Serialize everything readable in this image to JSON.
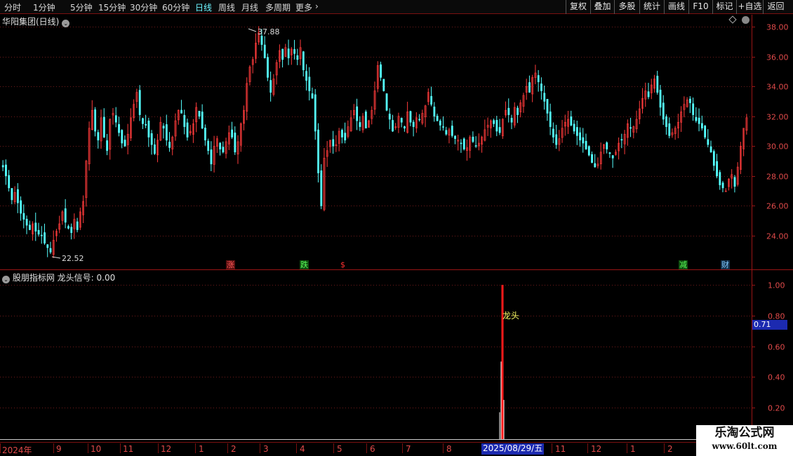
{
  "toolbar": {
    "periods": [
      "分时",
      "1分钟",
      "5分钟",
      "15分钟",
      "30分钟",
      "60分钟",
      "日线",
      "周线",
      "月线",
      "多周期",
      "更多"
    ],
    "active_period": "日线",
    "more_chevron": "›",
    "buttons": [
      "复权",
      "叠加",
      "多股",
      "统计",
      "画线",
      "F10",
      "标记",
      "+自选",
      "返回"
    ]
  },
  "main_panel": {
    "title": "华阳集团(日线)",
    "high_label": "37.88",
    "low_label": "22.52",
    "y_ticks": [
      "38.00",
      "36.00",
      "34.00",
      "32.00",
      "30.00",
      "28.00",
      "26.00",
      "24.00"
    ],
    "events": [
      {
        "text": "涨",
        "color": "#ff5a5a",
        "bg": "#5a1010"
      },
      {
        "text": "跌",
        "color": "#5aff5a",
        "bg": "#0f4a0f"
      },
      {
        "text": "$",
        "color": "#ff3030",
        "bg": "transparent"
      },
      {
        "text": "减",
        "color": "#5aff5a",
        "bg": "#0f4a0f"
      },
      {
        "text": "财",
        "color": "#7ec8ff",
        "bg": "#14304a"
      }
    ]
  },
  "indicator_panel": {
    "title": "股朋指标网 龙头信号: 0.00",
    "signal_label": "龙头",
    "current_value": "0.71",
    "y_ticks": [
      "1.00",
      "0.80",
      "0.60",
      "0.40",
      "0.20"
    ]
  },
  "time_axis": {
    "labels": [
      "2024年",
      "9",
      "10",
      "11",
      "12",
      "1",
      "2",
      "3",
      "4",
      "5",
      "6",
      "7",
      "8",
      "11",
      "12",
      "1",
      "2"
    ],
    "cursor_date": "2025/08/29/五"
  },
  "watermark": {
    "title": "乐淘公式网",
    "url": "www.60lt.com"
  },
  "colors": {
    "up": "#ff3b3b",
    "down": "#54ffff",
    "grid": "#6e1a1a",
    "axis_text": "#e04a4a",
    "active_period": "#6cf5ff",
    "signal_bar": "#ff1a1a",
    "signal_text": "#ffff66"
  },
  "chart_data": {
    "type": "candlestick",
    "ylim": [
      22.5,
      38.2
    ],
    "high": 37.88,
    "low": 22.52,
    "close_series": [
      28.6,
      28.0,
      27.2,
      26.4,
      26.9,
      26.2,
      25.5,
      25.1,
      24.7,
      24.4,
      24.8,
      24.3,
      24.1,
      24.0,
      23.5,
      23.2,
      22.9,
      23.7,
      24.3,
      24.8,
      25.6,
      24.9,
      24.5,
      24.2,
      25.1,
      24.4,
      25.6,
      26.3,
      29.0,
      31.2,
      32.4,
      31.0,
      30.4,
      31.9,
      30.6,
      29.7,
      31.8,
      32.2,
      31.6,
      30.9,
      30.2,
      30.0,
      30.8,
      31.9,
      32.8,
      33.6,
      32.1,
      31.5,
      31.4,
      30.6,
      30.1,
      29.5,
      30.4,
      31.6,
      31.2,
      30.4,
      29.9,
      30.6,
      31.7,
      32.4,
      32.2,
      31.3,
      30.6,
      31.0,
      31.5,
      32.6,
      32.0,
      31.2,
      30.4,
      29.7,
      28.8,
      30.0,
      30.5,
      29.8,
      29.6,
      30.3,
      30.9,
      30.6,
      29.6,
      30.3,
      31.5,
      32.4,
      34.2,
      35.3,
      35.8,
      36.9,
      37.6,
      36.8,
      35.9,
      34.6,
      33.6,
      34.5,
      35.6,
      36.4,
      35.8,
      36.6,
      35.9,
      36.5,
      36.2,
      35.8,
      36.6,
      35.1,
      34.4,
      33.7,
      33.2,
      31.0,
      28.2,
      26.0,
      29.2,
      29.7,
      30.4,
      30.0,
      30.1,
      31.0,
      30.6,
      30.4,
      31.3,
      31.9,
      32.4,
      31.7,
      31.3,
      32.0,
      31.2,
      31.7,
      32.4,
      33.7,
      35.4,
      34.6,
      33.7,
      32.4,
      31.8,
      31.0,
      31.3,
      32.0,
      31.6,
      31.2,
      32.3,
      31.6,
      31.3,
      31.9,
      31.8,
      32.2,
      32.7,
      33.6,
      32.8,
      32.0,
      31.7,
      31.4,
      31.3,
      30.8,
      31.1,
      30.7,
      30.5,
      30.4,
      30.2,
      29.8,
      29.9,
      30.6,
      30.3,
      30.0,
      30.2,
      30.6,
      31.1,
      31.4,
      31.7,
      31.5,
      31.0,
      30.9,
      31.8,
      32.4,
      32.1,
      31.6,
      32.6,
      32.1,
      32.9,
      33.4,
      34.0,
      33.6,
      34.6,
      34.9,
      34.3,
      33.7,
      33.0,
      32.2,
      31.3,
      30.6,
      30.1,
      30.5,
      31.2,
      31.6,
      31.8,
      31.4,
      31.0,
      30.7,
      30.4,
      30.2,
      29.8,
      29.4,
      28.9,
      28.6,
      28.8,
      29.6,
      30.1,
      29.8,
      29.5,
      29.2,
      29.6,
      30.2,
      30.4,
      30.8,
      31.5,
      31.2,
      31.3,
      31.8,
      32.5,
      33.2,
      33.7,
      33.3,
      34.1,
      34.5,
      33.6,
      32.6,
      31.8,
      31.3,
      30.7,
      30.9,
      31.2,
      31.6,
      32.3,
      32.8,
      33.1,
      32.9,
      32.1,
      31.7,
      31.5,
      31.2,
      30.6,
      30.1,
      29.6,
      28.7,
      28.0,
      27.4,
      27.2,
      27.0,
      27.8,
      28.1,
      27.3,
      28.6,
      30.0,
      31.2,
      31.9
    ],
    "signal": {
      "x_label": "2025/08/29/五",
      "values": [
        0.17,
        0.5,
        1.0,
        0.25
      ]
    },
    "indicator_ylim": [
      0.0,
      1.05
    ],
    "indicator_current": 0.71
  }
}
